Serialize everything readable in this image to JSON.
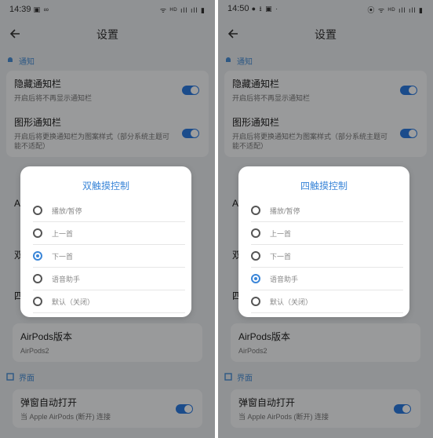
{
  "screens": [
    {
      "status_time": "14:39",
      "status_left_icons": "▣ ∞",
      "status_right_icons": "ᯤ ᴴᴰ ıll ıll ▮",
      "title": "设置",
      "sections": {
        "notify_header": "通知",
        "hide_notify_title": "隐藏通知栏",
        "hide_notify_sub": "开启后将不再显示通知栏",
        "graphic_notify_title": "图形通知栏",
        "graphic_notify_sub": "开启后将更换通知栏为图案样式（部分系统主题可能不适配）",
        "peek_letter_a": "A",
        "peek_letter_b": "双",
        "peek_letter_c": "四",
        "airpods_version_title": "AirPods版本",
        "airpods_version_value": "AirPods2",
        "ui_header": "界面",
        "popup_title": "弹窗自动打开",
        "popup_sub": "当 Apple AirPods (断开) 连接"
      },
      "dialog": {
        "title": "双触摸控制",
        "options": [
          "播放/暂停",
          "上一首",
          "下一首",
          "语音助手",
          "默认（关闭）"
        ],
        "selected_index": 2
      }
    },
    {
      "status_time": "14:50",
      "status_left_icons": "● ⭳ ▣ ·",
      "status_right_icons": "⦿ ᯤ ᴴᴰ ıll ıll ▮",
      "title": "设置",
      "sections": {
        "notify_header": "通知",
        "hide_notify_title": "隐藏通知栏",
        "hide_notify_sub": "开启后将不再显示通知栏",
        "graphic_notify_title": "图形通知栏",
        "graphic_notify_sub": "开启后将更换通知栏为图案样式（部分系统主题可能不适配）",
        "peek_letter_a": "A",
        "peek_letter_b": "双",
        "peek_letter_c": "四",
        "airpods_version_title": "AirPods版本",
        "airpods_version_value": "AirPods2",
        "ui_header": "界面",
        "popup_title": "弹窗自动打开",
        "popup_sub": "当 Apple AirPods (断开) 连接"
      },
      "dialog": {
        "title": "四触摸控制",
        "options": [
          "播放/暂停",
          "上一首",
          "下一首",
          "语音助手",
          "默认（关闭）"
        ],
        "selected_index": 3
      }
    }
  ],
  "colors": {
    "accent": "#3b86d8",
    "toggle_on": "#2d7be0",
    "background": "#e9ecef"
  }
}
